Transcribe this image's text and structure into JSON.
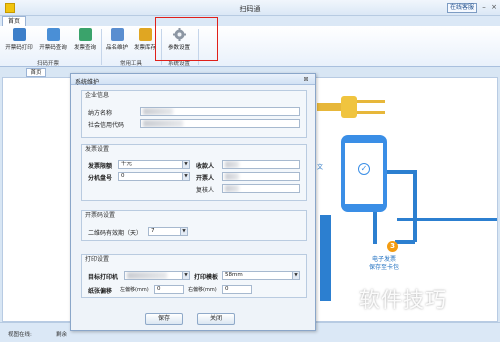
{
  "window": {
    "title": "扫码通",
    "online_service": "在线客服",
    "minimize": "–",
    "close": "×"
  },
  "ribbon": {
    "tab": "首页",
    "buttons": [
      {
        "label": "开票码打印",
        "icon": "print-qr-icon"
      },
      {
        "label": "开票码查询",
        "icon": "query-qr-icon"
      },
      {
        "label": "发票查询",
        "icon": "invoice-query-icon"
      },
      {
        "label": "品名维护",
        "icon": "product-name-icon"
      },
      {
        "label": "发票库存",
        "icon": "invoice-stock-icon"
      },
      {
        "label": "参数设置",
        "icon": "gear-icon"
      }
    ],
    "groups": [
      "扫码开票",
      "常用工具",
      "系统设置"
    ]
  },
  "doc_tab": "首页",
  "background": {
    "step_number": "3",
    "step_text": "电子发票\n保存至卡包",
    "side_text": "文",
    "watermark": "软件技巧"
  },
  "status": {
    "left": "视图在线:",
    "right": "剩余"
  },
  "dialog": {
    "title": "系统维护",
    "close": "⊠",
    "company": {
      "title": "企业信息",
      "name_label": "纳方名称",
      "credit_label": "社会信用代码"
    },
    "invoice": {
      "title": "发票设置",
      "limit_label": "发票限额",
      "limit_value": "千元",
      "ext_label": "分机盘号",
      "ext_value": "0",
      "payee_label": "收款人",
      "drawer_label": "开票人",
      "reviewer_label": "复核人"
    },
    "qr": {
      "title": "开票码设置",
      "valid_label": "二维码有效期（天）",
      "valid_value": "7"
    },
    "print": {
      "title": "打印设置",
      "printer_label": "目标打印机",
      "template_label": "打印模板",
      "template_value": "58mm",
      "offset_label": "纸张偏移",
      "left_label": "左偏移(mm)",
      "left_value": "0",
      "right_label": "右偏移(mm)",
      "right_value": "0"
    },
    "save": "保存",
    "close_btn": "关闭"
  },
  "colors": {
    "accent": "#2c7fd0",
    "highlight": "#e0201a",
    "badge": "#f39c12"
  }
}
